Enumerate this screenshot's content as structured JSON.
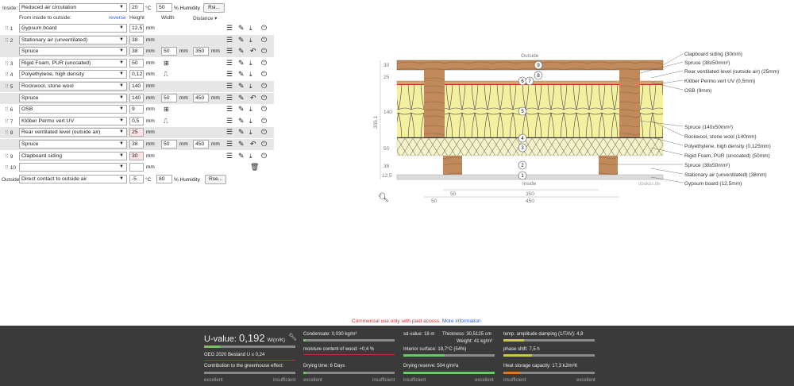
{
  "inside": {
    "label": "Inside:",
    "select": "Reduced air circulation",
    "temp": "20",
    "temp_unit": "°C",
    "humidity": "50",
    "humidity_unit": "% Humidity",
    "rsi_button": "Rsi..."
  },
  "headers": {
    "from_inside": "From inside to outside:",
    "reverse": "reverse",
    "height": "Height",
    "width": "Width",
    "distance": "Distance ▾"
  },
  "rows": [
    {
      "num": "1",
      "material": "Gypsum board",
      "height": "12,5",
      "unit": "mm"
    },
    {
      "num": "2",
      "material": "Stationary air (unventilated)",
      "height": "38",
      "unit": "mm"
    },
    {
      "num": "",
      "material": "Spruce",
      "height": "38",
      "unit": "mm",
      "width": "50",
      "width_unit": "mm",
      "distance": "350",
      "distance_unit": "mm"
    },
    {
      "num": "3",
      "material": "Rigid Foam, PUR (uncoated)",
      "height": "50",
      "unit": "mm"
    },
    {
      "num": "4",
      "material": "Polyethylene, high density",
      "height": "0,12",
      "unit": "mm"
    },
    {
      "num": "5",
      "material": "Rockwool, stone wool",
      "height": "140",
      "unit": "mm"
    },
    {
      "num": "",
      "material": "Spruce",
      "height": "140",
      "unit": "mm",
      "width": "50",
      "width_unit": "mm",
      "distance": "450",
      "distance_unit": "mm"
    },
    {
      "num": "6",
      "material": "OSB",
      "height": "9",
      "unit": "mm"
    },
    {
      "num": "7",
      "material": "Klöber Permo vert UV",
      "height": "0,5",
      "unit": "mm"
    },
    {
      "num": "8",
      "material": "Rear ventilated level (outside air)",
      "height": "25",
      "unit": "mm"
    },
    {
      "num": "",
      "material": "Spruce",
      "height": "38",
      "unit": "mm",
      "width": "50",
      "width_unit": "mm",
      "distance": "450",
      "distance_unit": "mm"
    },
    {
      "num": "9",
      "material": "Clapboard siding",
      "height": "30",
      "unit": "mm"
    },
    {
      "num": "10",
      "material": "",
      "height": "",
      "unit": "mm"
    }
  ],
  "outside": {
    "label": "Outside",
    "select": "Direct contact to outside air",
    "temp": "-5",
    "temp_unit": "°C",
    "humidity": "80",
    "humidity_unit": "% Humidity",
    "rse_button": "Rse..."
  },
  "diagram": {
    "outside_label": "Outside",
    "inside_label": "Inside",
    "watermark": "ubakus.de",
    "left_dims": [
      "30",
      "25",
      "140",
      "50",
      "38",
      "12,5"
    ],
    "total_height": "305,1",
    "bottom_dims": [
      "50",
      "350",
      "50",
      "450"
    ],
    "layer_labels": [
      "Clapboard siding (30mm)",
      "Spruce (38x50mm²)",
      "Rear ventilated level (outside air) (25mm)",
      "Klöber Permo vert UV (0,5mm)",
      "OSB (9mm)",
      "Spruce (140x50mm²)",
      "Rockwool, stone wool (140mm)",
      "Polyethylene, high density (0,125mm)",
      "Rigid Foam, PUR (uncoated) (50mm)",
      "Spruce (38x50mm²)",
      "Stationary air (unventilated) (38mm)",
      "Gypsum board (12,5mm)"
    ],
    "circle_numbers": [
      "9",
      "8",
      "6",
      "7",
      "5",
      "4",
      "3",
      "2",
      "1"
    ]
  },
  "notice": {
    "text": "Commercial use only with paid access.",
    "link": "More information"
  },
  "results": {
    "u_label": "U-value:",
    "u_value": "0,192",
    "u_unit": "W/(m²K)",
    "geg": "GEG 2020 Bestand U ≤ 0,24",
    "greenhouse": "Contribution to the greenhouse effect:",
    "condensate": "Condensate: 0,030 kg/m²",
    "moisture": "moisture content of wood: +0,4 %",
    "drying_time": "Drying time: 6 Days",
    "sd": "sd-value: 18 m",
    "thickness": "Thickness: 30,5125 cm",
    "weight": "Weight: 41 kg/m²",
    "interior_surface": "Interior surface: 18,7°C (54%)",
    "drying_reserve": "Drying reserve: 504 g/m²a",
    "tav": "temp. amplitude damping (1/TAV): 4,8",
    "phase_shift": "phase shift: 7,5 h",
    "heat_storage": "Heat storage capacity: 17,3 kJ/m²K",
    "excellent": "excellent",
    "insufficient": "insufficient"
  },
  "colors": {
    "wood": "#c08a5c",
    "insulation": "#f3f0a0",
    "foam": "#f5f2c8",
    "bar_bg": "#3a3a3a",
    "accent_blue": "#2b5fd9"
  }
}
